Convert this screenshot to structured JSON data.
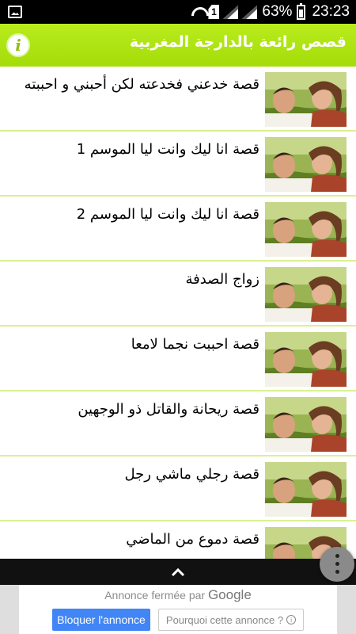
{
  "status_bar": {
    "notification_icon": "image-notification-icon",
    "sim_slot": "1",
    "battery_percent": "63%",
    "time": "23:23"
  },
  "app_bar": {
    "title": "قصص رائعة بالدارجة المغربية",
    "info_icon": "info-icon"
  },
  "stories": [
    {
      "title": "قصة  خدعني فخدعته لكن أحبني و احببته"
    },
    {
      "title": "قصة انا ليك وانت ليا الموسم 1"
    },
    {
      "title": "قصة انا ليك وانت ليا الموسم 2"
    },
    {
      "title": "زواج الصدفة"
    },
    {
      "title": "قصة  احببت نجما لامعا"
    },
    {
      "title": "قصة ريحانة والقاتل ذو الوجهين"
    },
    {
      "title": "قصة رجلي ماشي رجل"
    },
    {
      "title": "قصة دموع من الماضي"
    }
  ],
  "ad": {
    "closed_text": "Annonce fermée par",
    "closed_brand": "Google",
    "block_label": "Bloquer l'annonce",
    "why_label": "Pourquoi cette annonce ?"
  },
  "colors": {
    "app_bar": "#a4dc09",
    "divider": "#d9f18e",
    "ad_button": "#4285f4"
  }
}
